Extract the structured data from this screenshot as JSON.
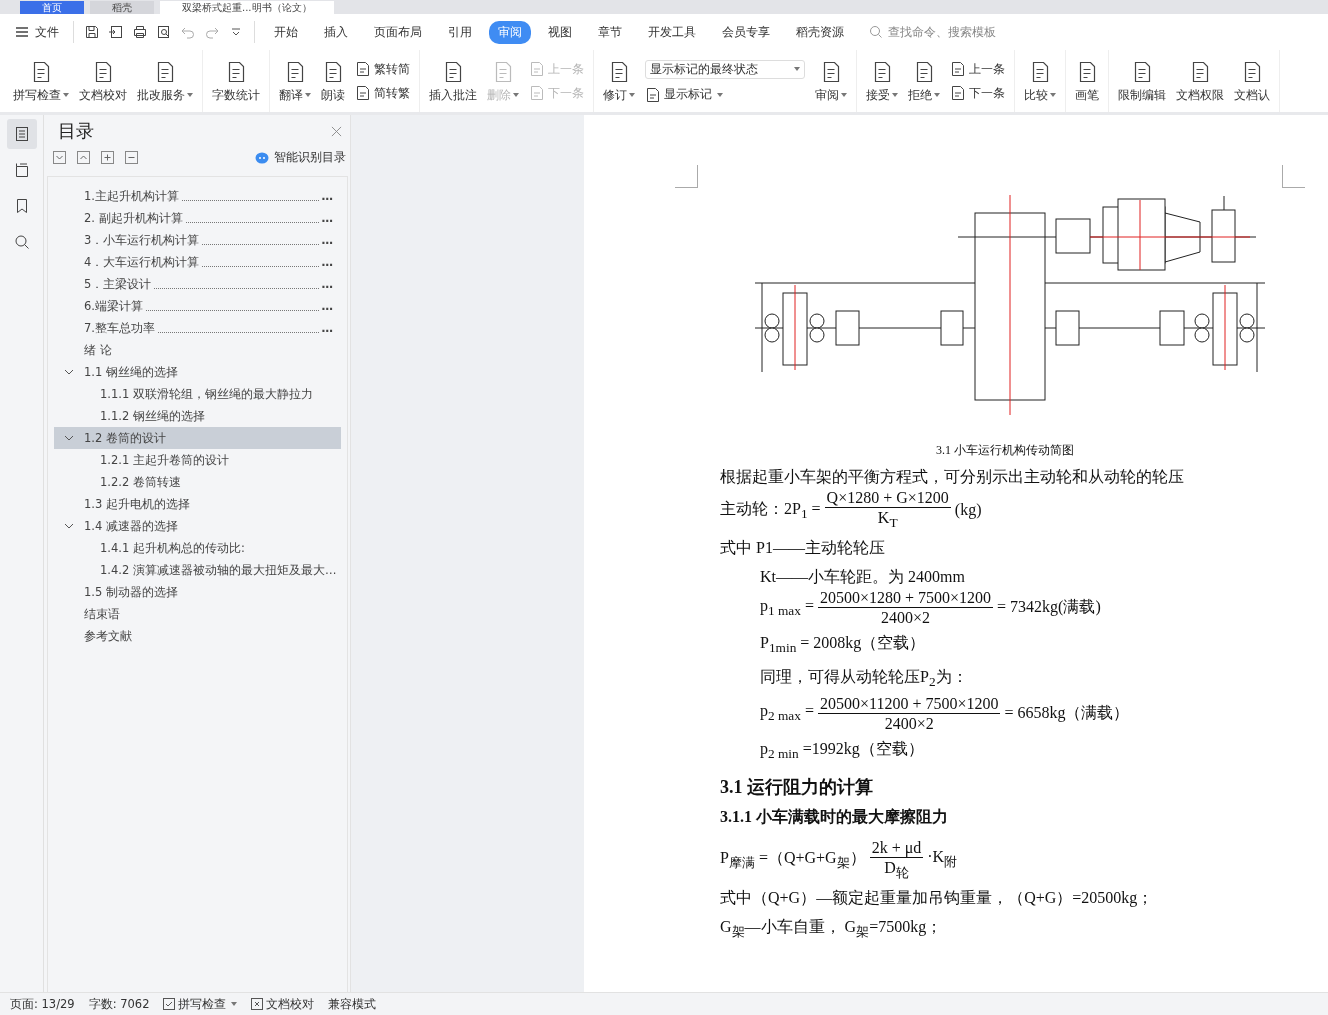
{
  "window_tabs": [
    {
      "label": "首页",
      "selected": false,
      "kind": "home"
    },
    {
      "label": "稻壳",
      "selected": false,
      "kind": "doc"
    },
    {
      "label": "双梁桥式起重...明书（论文）",
      "selected": true,
      "kind": "doc"
    }
  ],
  "menu": {
    "file": "文件",
    "tabs": [
      {
        "label": "开始",
        "selected": false
      },
      {
        "label": "插入",
        "selected": false
      },
      {
        "label": "页面布局",
        "selected": false
      },
      {
        "label": "引用",
        "selected": false
      },
      {
        "label": "审阅",
        "selected": true
      },
      {
        "label": "视图",
        "selected": false
      },
      {
        "label": "章节",
        "selected": false
      },
      {
        "label": "开发工具",
        "selected": false
      },
      {
        "label": "会员专享",
        "selected": false
      },
      {
        "label": "稻壳资源",
        "selected": false
      }
    ],
    "search": {
      "placeholder": "查找命令、搜索模板"
    }
  },
  "ribbon": [
    [
      {
        "kind": "big",
        "label": "拼写检查",
        "dropdown": true,
        "disabled": false
      },
      {
        "kind": "big",
        "label": "文档校对",
        "dropdown": false,
        "disabled": false
      },
      {
        "kind": "big",
        "label": "批改服务",
        "dropdown": true,
        "disabled": false
      }
    ],
    [
      {
        "kind": "big",
        "label": "字数统计",
        "dropdown": false,
        "disabled": false
      }
    ],
    [
      {
        "kind": "big",
        "label": "翻译",
        "dropdown": true,
        "disabled": false
      },
      {
        "kind": "big",
        "label": "朗读",
        "dropdown": false,
        "disabled": false
      },
      {
        "kind": "stack",
        "items": [
          {
            "label": "繁转简",
            "disabled": false
          },
          {
            "label": "简转繁",
            "disabled": false
          }
        ]
      }
    ],
    [
      {
        "kind": "big",
        "label": "插入批注",
        "dropdown": false,
        "disabled": false
      },
      {
        "kind": "big",
        "label": "删除",
        "dropdown": true,
        "disabled": true
      },
      {
        "kind": "stack",
        "items": [
          {
            "label": "上一条",
            "disabled": true
          },
          {
            "label": "下一条",
            "disabled": true
          }
        ]
      }
    ],
    [
      {
        "kind": "big",
        "label": "修订",
        "dropdown": true,
        "disabled": false
      },
      {
        "kind": "select",
        "value": "显示标记的最终状态",
        "label": "显示标记"
      },
      {
        "kind": "big",
        "label": "审阅",
        "dropdown": true,
        "disabled": false
      }
    ],
    [
      {
        "kind": "big",
        "label": "接受",
        "dropdown": true,
        "disabled": false
      },
      {
        "kind": "big",
        "label": "拒绝",
        "dropdown": true,
        "disabled": false
      },
      {
        "kind": "stack",
        "items": [
          {
            "label": "上一条",
            "disabled": false
          },
          {
            "label": "下一条",
            "disabled": false
          }
        ]
      }
    ],
    [
      {
        "kind": "big",
        "label": "比较",
        "dropdown": true,
        "disabled": false
      }
    ],
    [
      {
        "kind": "big",
        "label": "画笔",
        "dropdown": false,
        "disabled": false
      }
    ],
    [
      {
        "kind": "big",
        "label": "限制编辑",
        "dropdown": false,
        "disabled": false
      },
      {
        "kind": "big",
        "label": "文档权限",
        "dropdown": false,
        "disabled": false
      },
      {
        "kind": "big",
        "label": "文档认",
        "dropdown": false,
        "disabled": false
      }
    ]
  ],
  "rail": [
    {
      "selected": true
    },
    {
      "selected": false
    },
    {
      "selected": false
    },
    {
      "selected": false
    }
  ],
  "sidebar": {
    "title": "目录",
    "smart": "智能识别目录",
    "toc": [
      {
        "label": "1.主起升机构计算",
        "leader": true,
        "tail": "…",
        "selected": false
      },
      {
        "label": "2. 副起升机构计算",
        "leader": true,
        "tail": "…",
        "selected": false
      },
      {
        "label": "3．小车运行机构计算",
        "leader": true,
        "tail": "…",
        "selected": false
      },
      {
        "label": "4．大车运行机构计算",
        "leader": true,
        "tail": "…",
        "selected": false
      },
      {
        "label": "5．主梁设计",
        "leader": true,
        "tail": "…",
        "selected": false
      },
      {
        "label": "6.端梁计算",
        "leader": true,
        "tail": "…",
        "selected": false
      },
      {
        "label": "7.整车总功率",
        "leader": true,
        "tail": "…",
        "selected": false
      },
      {
        "label": "绪  论",
        "leader": false,
        "selected": false
      },
      {
        "label": "1.1 钢丝绳的选择",
        "leader": false,
        "selected": false,
        "expanded": true,
        "children": [
          {
            "label": "1.1.1 双联滑轮组，钢丝绳的最大静拉力",
            "leader": false,
            "selected": false
          },
          {
            "label": "1.1.2 钢丝绳的选择",
            "leader": false,
            "selected": false
          }
        ]
      },
      {
        "label": "1.2 卷筒的设计",
        "leader": false,
        "selected": true,
        "expanded": true,
        "children": [
          {
            "label": "1.2.1 主起升卷筒的设计",
            "leader": false,
            "selected": false
          },
          {
            "label": "1.2.2 卷筒转速",
            "leader": false,
            "selected": false
          }
        ]
      },
      {
        "label": "1.3 起升电机的选择",
        "leader": false,
        "selected": false
      },
      {
        "label": "1.4 减速器的选择",
        "leader": false,
        "selected": false,
        "expanded": true,
        "children": [
          {
            "label": "1.4.1 起升机构总的传动比:",
            "leader": false,
            "selected": false
          },
          {
            "label": "1.4.2 演算减速器被动轴的最大扭矩及最大…",
            "leader": false,
            "selected": false
          }
        ]
      },
      {
        "label": "1.5 制动器的选择",
        "leader": false,
        "selected": false
      },
      {
        "label": "结束语",
        "leader": false,
        "selected": false
      },
      {
        "label": "参考文献",
        "leader": false,
        "selected": false
      }
    ]
  },
  "document": [
    {
      "kind": "caption",
      "text": "3.1  小车运行机构传动简图",
      "indented": false
    },
    {
      "kind": "para",
      "text": "根据起重小车架的平衡方程式，可分别示出主动轮和从动轮的轮压",
      "indented": false
    },
    {
      "kind": "frac",
      "prefix": "主动轮：2P$_{1}$ =",
      "num": "Q×1280 + G×1200",
      "den": "K$_{T}$",
      "suffix": "(kg)",
      "indented": false
    },
    {
      "kind": "para",
      "text": "式中 P1——主动轮轮压",
      "indented": false
    },
    {
      "kind": "para",
      "text": "Kt——小车轮距。为 2400mm",
      "indented": true
    },
    {
      "kind": "frac",
      "prefix": "p$_{1 max}$ =",
      "num": "20500×1280 + 7500×1200",
      "den": "2400×2",
      "suffix": "= 7342kg(满载)",
      "indented": true
    },
    {
      "kind": "para",
      "text": "P$_{1min}$ = 2008kg（空载）",
      "indented": true
    },
    {
      "kind": "para",
      "text": "同理，可得从动轮轮压P$_{2}$为：",
      "indented": true
    },
    {
      "kind": "frac",
      "prefix": "p$_{2 max}$ =",
      "num": "20500×11200 + 7500×1200",
      "den": "2400×2",
      "suffix": "= 6658kg（满载）",
      "indented": true
    },
    {
      "kind": "para",
      "text": "p$_{2 min}$ =1992kg（空载）",
      "indented": true
    },
    {
      "kind": "heading",
      "text": "3.1 运行阻力的计算",
      "indented": false
    },
    {
      "kind": "subheading",
      "text": "3.1.1 小车满载时的最大摩擦阻力",
      "indented": false
    },
    {
      "kind": "frac",
      "prefix": "P$_{摩满}$ =（Q+G+G$_{架}$）",
      "num": "2k + μd",
      "den": "D$_{轮}$",
      "suffix": "·K$_{附}$",
      "indented": false
    },
    {
      "kind": "para",
      "text": "式中（Q+G）—额定起重量加吊钩重量，（Q+G）=20500kg；",
      "indented": false
    },
    {
      "kind": "para",
      "text": "G$_{架}$—小车自重， G$_{架}$=7500kg；",
      "indented": false
    }
  ],
  "status_bar": {
    "page": "页面: 13/29",
    "words": "字数: 7062",
    "spell": "拼写检查",
    "proof": "文档校对",
    "mode": "兼容模式"
  }
}
